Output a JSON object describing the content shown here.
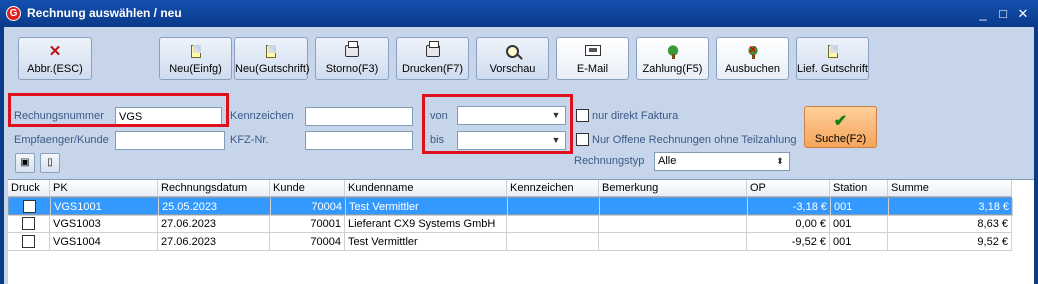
{
  "window": {
    "title": "Rechnung auswählen / neu",
    "icon_letter": "G",
    "controls": {
      "minimize": "_",
      "maximize": "□",
      "close": "✕"
    }
  },
  "toolbar": {
    "cancel": "Abbr.(ESC)",
    "new": "Neu(Einfg)",
    "new_credit": "Neu(Gutschrift)",
    "cancel_invoice": "Storno(F3)",
    "print": "Drucken(F7)",
    "preview": "Vorschau",
    "email": "E-Mail",
    "payment": "Zahlung(F5)",
    "book_out": "Ausbuchen",
    "supplier_credit": "Lief. Gutschrift"
  },
  "filters": {
    "invoice_number_label": "Rechungsnummer",
    "invoice_number_value": "VGS",
    "recipient_label": "Empfaenger/Kunde",
    "recipient_value": "",
    "plate_label": "Kennzeichen",
    "plate_value": "",
    "vin_label": "KFZ-Nr.",
    "vin_value": "",
    "from_label": "von",
    "from_value": "",
    "to_label": "bis",
    "to_value": "",
    "direct_billing_label": "nur direkt Faktura",
    "open_only_label": "Nur Offene Rechnungen ohne Teilzahlung",
    "invoice_type_label": "Rechnungstyp",
    "invoice_type_value": "Alle",
    "search_button": "Suche(F2)"
  },
  "grid": {
    "columns": [
      "Druck",
      "PK",
      "Rechnungsdatum",
      "Kunde",
      "Kundenname",
      "Kennzeichen",
      "Bemerkung",
      "OP",
      "Station",
      "Summe"
    ],
    "rows": [
      {
        "pk": "VGS1001",
        "date": "25.05.2023",
        "customer": "70004",
        "name": "Test Vermittler",
        "plate": "",
        "note": "",
        "op": "-3,18 €",
        "station": "001",
        "sum": "3,18 €",
        "selected": true
      },
      {
        "pk": "VGS1003",
        "date": "27.06.2023",
        "customer": "70001",
        "name": "Lieferant CX9 Systems GmbH",
        "plate": "",
        "note": "",
        "op": "0,00 €",
        "station": "001",
        "sum": "8,63 €",
        "selected": false
      },
      {
        "pk": "VGS1004",
        "date": "27.06.2023",
        "customer": "70004",
        "name": "Test Vermittler",
        "plate": "",
        "note": "",
        "op": "-9,52 €",
        "station": "001",
        "sum": "9,52 €",
        "selected": false
      }
    ]
  },
  "colors": {
    "selection": "#3399ff",
    "highlight_box": "#e0101a",
    "search_button": "#f4a55a",
    "panel": "#c6d5ea"
  }
}
